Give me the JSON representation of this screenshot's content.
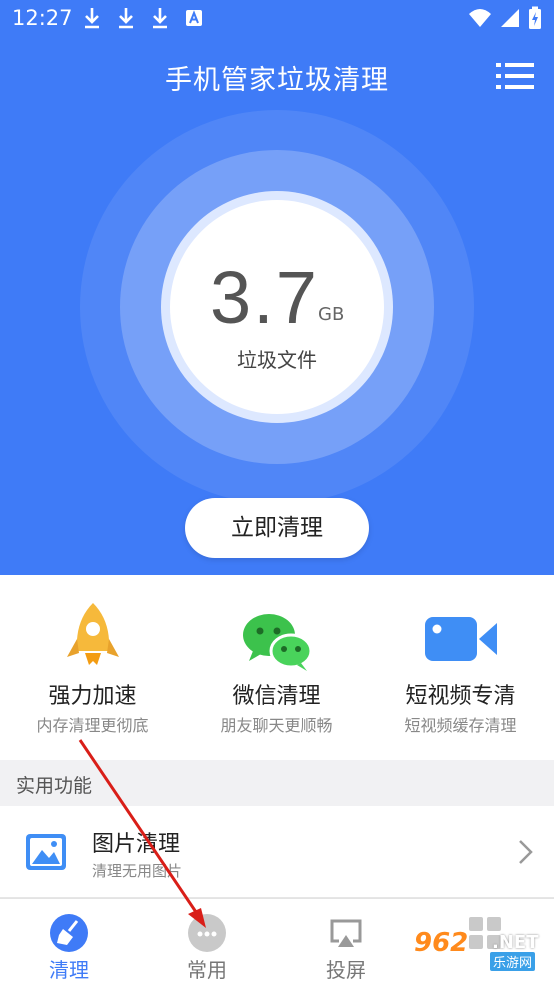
{
  "status": {
    "time": "12:27"
  },
  "header": {
    "title": "手机管家垃圾清理"
  },
  "junk": {
    "value": "3.7",
    "unit": "GB",
    "label": "垃圾文件"
  },
  "clean_button": "立即清理",
  "features": [
    {
      "title": "强力加速",
      "subtitle": "内存清理更彻底",
      "icon": "rocket-icon"
    },
    {
      "title": "微信清理",
      "subtitle": "朋友聊天更顺畅",
      "icon": "wechat-icon"
    },
    {
      "title": "短视频专清",
      "subtitle": "短视频缓存清理",
      "icon": "video-camera-icon"
    }
  ],
  "section": {
    "title": "实用功能"
  },
  "list": [
    {
      "title": "图片清理",
      "subtitle": "清理无用图片",
      "icon": "image-icon"
    }
  ],
  "nav": [
    {
      "label": "清理",
      "icon": "broom-icon",
      "active": true
    },
    {
      "label": "常用",
      "icon": "dots-icon",
      "active": false
    },
    {
      "label": "投屏",
      "icon": "cast-icon",
      "active": false
    },
    {
      "label": "",
      "icon": "grid-icon",
      "active": false
    }
  ],
  "watermark": {
    "brand": "962",
    "tld": ".NET",
    "sub": "乐游网"
  },
  "colors": {
    "primary": "#3f7bf7",
    "annotation_arrow": "#d91e18"
  }
}
